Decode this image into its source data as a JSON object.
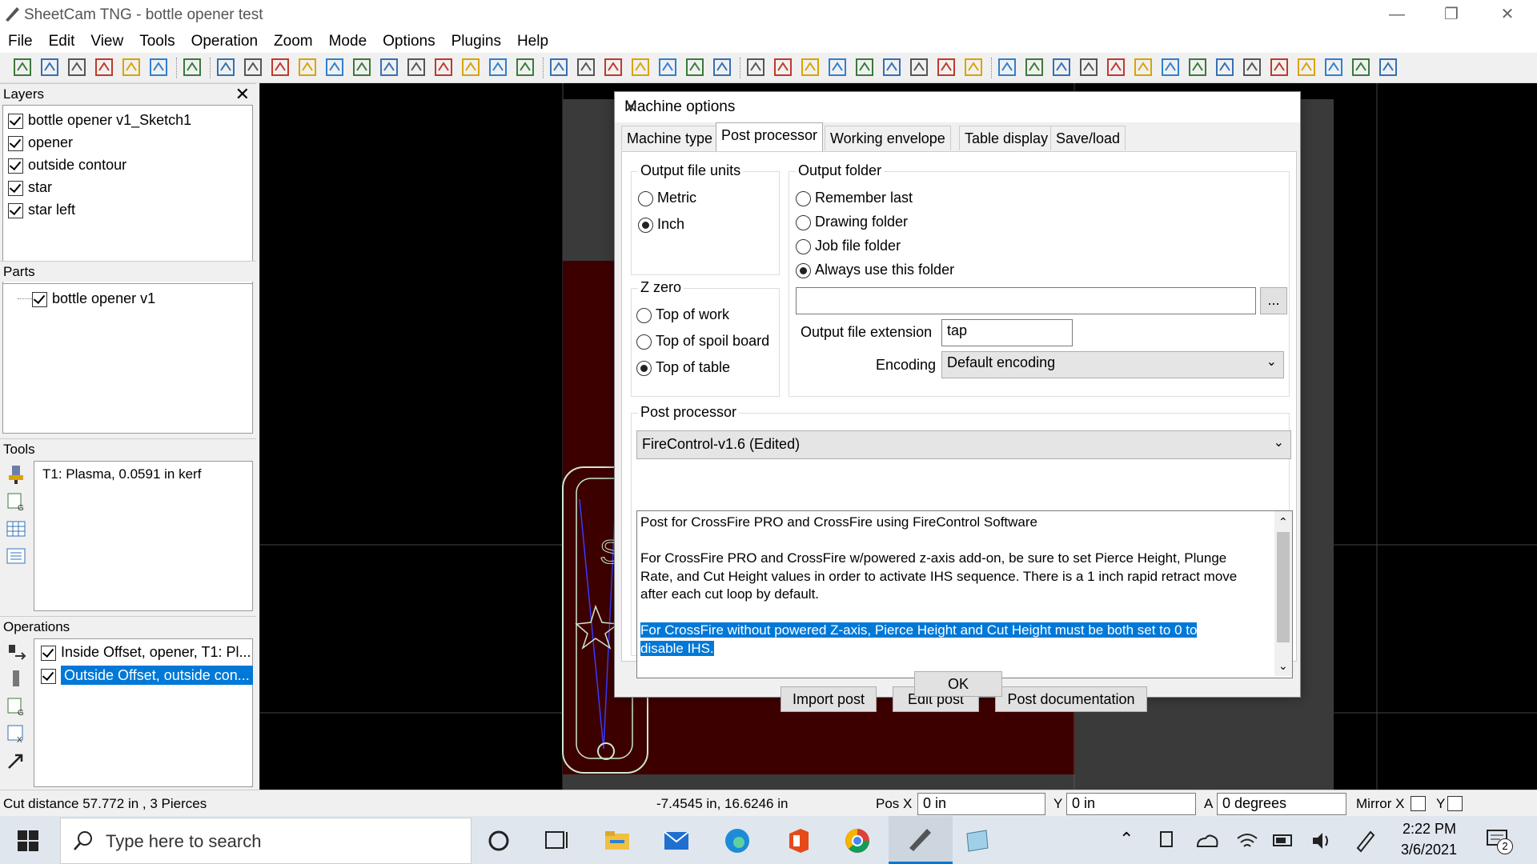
{
  "window": {
    "title": "SheetCam TNG - bottle opener test",
    "faded_menu": [
      "File",
      "Edit",
      "View",
      "Tools",
      "Operation",
      "Zoom",
      "Mode",
      "Options",
      "Plugins",
      "Help"
    ]
  },
  "menubar": [
    "File",
    "Edit",
    "View",
    "Tools",
    "Operation",
    "Zoom",
    "Mode",
    "Options",
    "Plugins",
    "Help"
  ],
  "toolbar_icons": [
    "new-file",
    "open-file",
    "print-setup",
    "print",
    "calculator",
    "tool-info",
    "undo",
    "draw-rect",
    "draw-polyline",
    "draw-curve",
    "offset",
    "drill",
    "line",
    "insert-part",
    "plasma-s",
    "edit-outline",
    "transform",
    "layers",
    "panel",
    "zoom-in",
    "zoom-out",
    "zoom-pan",
    "zoom-fit",
    "zoom-window",
    "zoom-select",
    "zoom-custom",
    "select-arrow",
    "select-s",
    "select-path",
    "select-multi",
    "select-box",
    "move",
    "scale",
    "rotate",
    "text-tool",
    "op-1",
    "op-2",
    "op-3",
    "op-4",
    "op-5",
    "op-6",
    "op-7",
    "op-8",
    "op-9",
    "op-10",
    "op-11",
    "op-12",
    "op-13",
    "op-14",
    "op-15"
  ],
  "layers": {
    "header": "Layers",
    "items": [
      {
        "label": "bottle opener v1_Sketch1",
        "checked": true
      },
      {
        "label": "opener",
        "checked": true
      },
      {
        "label": "outside contour",
        "checked": true
      },
      {
        "label": "star",
        "checked": true
      },
      {
        "label": "star left",
        "checked": true
      }
    ]
  },
  "parts": {
    "header": "Parts",
    "items": [
      {
        "label": "bottle opener v1",
        "checked": true
      }
    ]
  },
  "tools": {
    "header": "Tools",
    "items": [
      {
        "label": "T1: Plasma, 0.0591 in kerf"
      }
    ]
  },
  "operations": {
    "header": "Operations",
    "items": [
      {
        "label": "Inside Offset, opener, T1: Pl...",
        "checked": true,
        "selected": false
      },
      {
        "label": "Outside Offset, outside con...",
        "checked": true,
        "selected": true
      }
    ]
  },
  "dialog": {
    "title": "Machine options",
    "tabs": [
      "Machine type",
      "Post processor",
      "Working envelope",
      "Table display",
      "Save/load"
    ],
    "active_tab": "Post processor",
    "output_units": {
      "label": "Output file units",
      "options": [
        "Metric",
        "Inch"
      ],
      "selected": "Inch"
    },
    "z_zero": {
      "label": "Z zero",
      "options": [
        "Top of work",
        "Top of spoil board",
        "Top of table"
      ],
      "selected": "Top of table"
    },
    "output_folder": {
      "label": "Output folder",
      "options": [
        "Remember last",
        "Drawing folder",
        "Job file folder",
        "Always use this folder"
      ],
      "selected": "Always use this folder",
      "path_value": "",
      "browse_label": "..."
    },
    "extension": {
      "label": "Output file extension",
      "value": "tap"
    },
    "encoding": {
      "label": "Encoding",
      "value": "Default encoding"
    },
    "post_processor": {
      "label": "Post processor",
      "value": "FireControl-v1.6 (Edited)",
      "description": [
        "Post for CrossFire PRO and CrossFire using FireControl Software",
        "",
        "For CrossFire PRO and CrossFire w/powered z-axis add-on, be sure to set Pierce Height, Plunge",
        "Rate, and Cut Height values in order to activate IHS sequence. There is a 1 inch rapid retract move",
        "after each cut loop by default.",
        ""
      ],
      "highlighted": [
        "For CrossFire without powered Z-axis, Pierce Height and Cut Height must be both set to 0 to",
        "disable IHS."
      ]
    },
    "buttons": {
      "import": "Import post",
      "edit": "Edit post",
      "docs": "Post documentation",
      "ok": "OK"
    }
  },
  "statusbar": {
    "cut_info": "Cut distance 57.772 in , 3 Pierces",
    "coords": "-7.4545 in, 16.6246 in",
    "pos_x_label": "Pos X",
    "pos_x": "0 in",
    "y_label": "Y",
    "y_value": "0 in",
    "a_label": "A",
    "a_value": "0 degrees",
    "mirror_x_label": "Mirror X",
    "mirror_y_label": "Y"
  },
  "taskbar": {
    "search_placeholder": "Type here to search",
    "time": "2:22 PM",
    "date": "3/6/2021",
    "notifications": "2"
  },
  "colors": {
    "accent": "#0078d7",
    "canvas_bg": "#000000",
    "material_red": "#3d0000",
    "grid_line": "#444444",
    "contour": "#cfe8cf"
  }
}
